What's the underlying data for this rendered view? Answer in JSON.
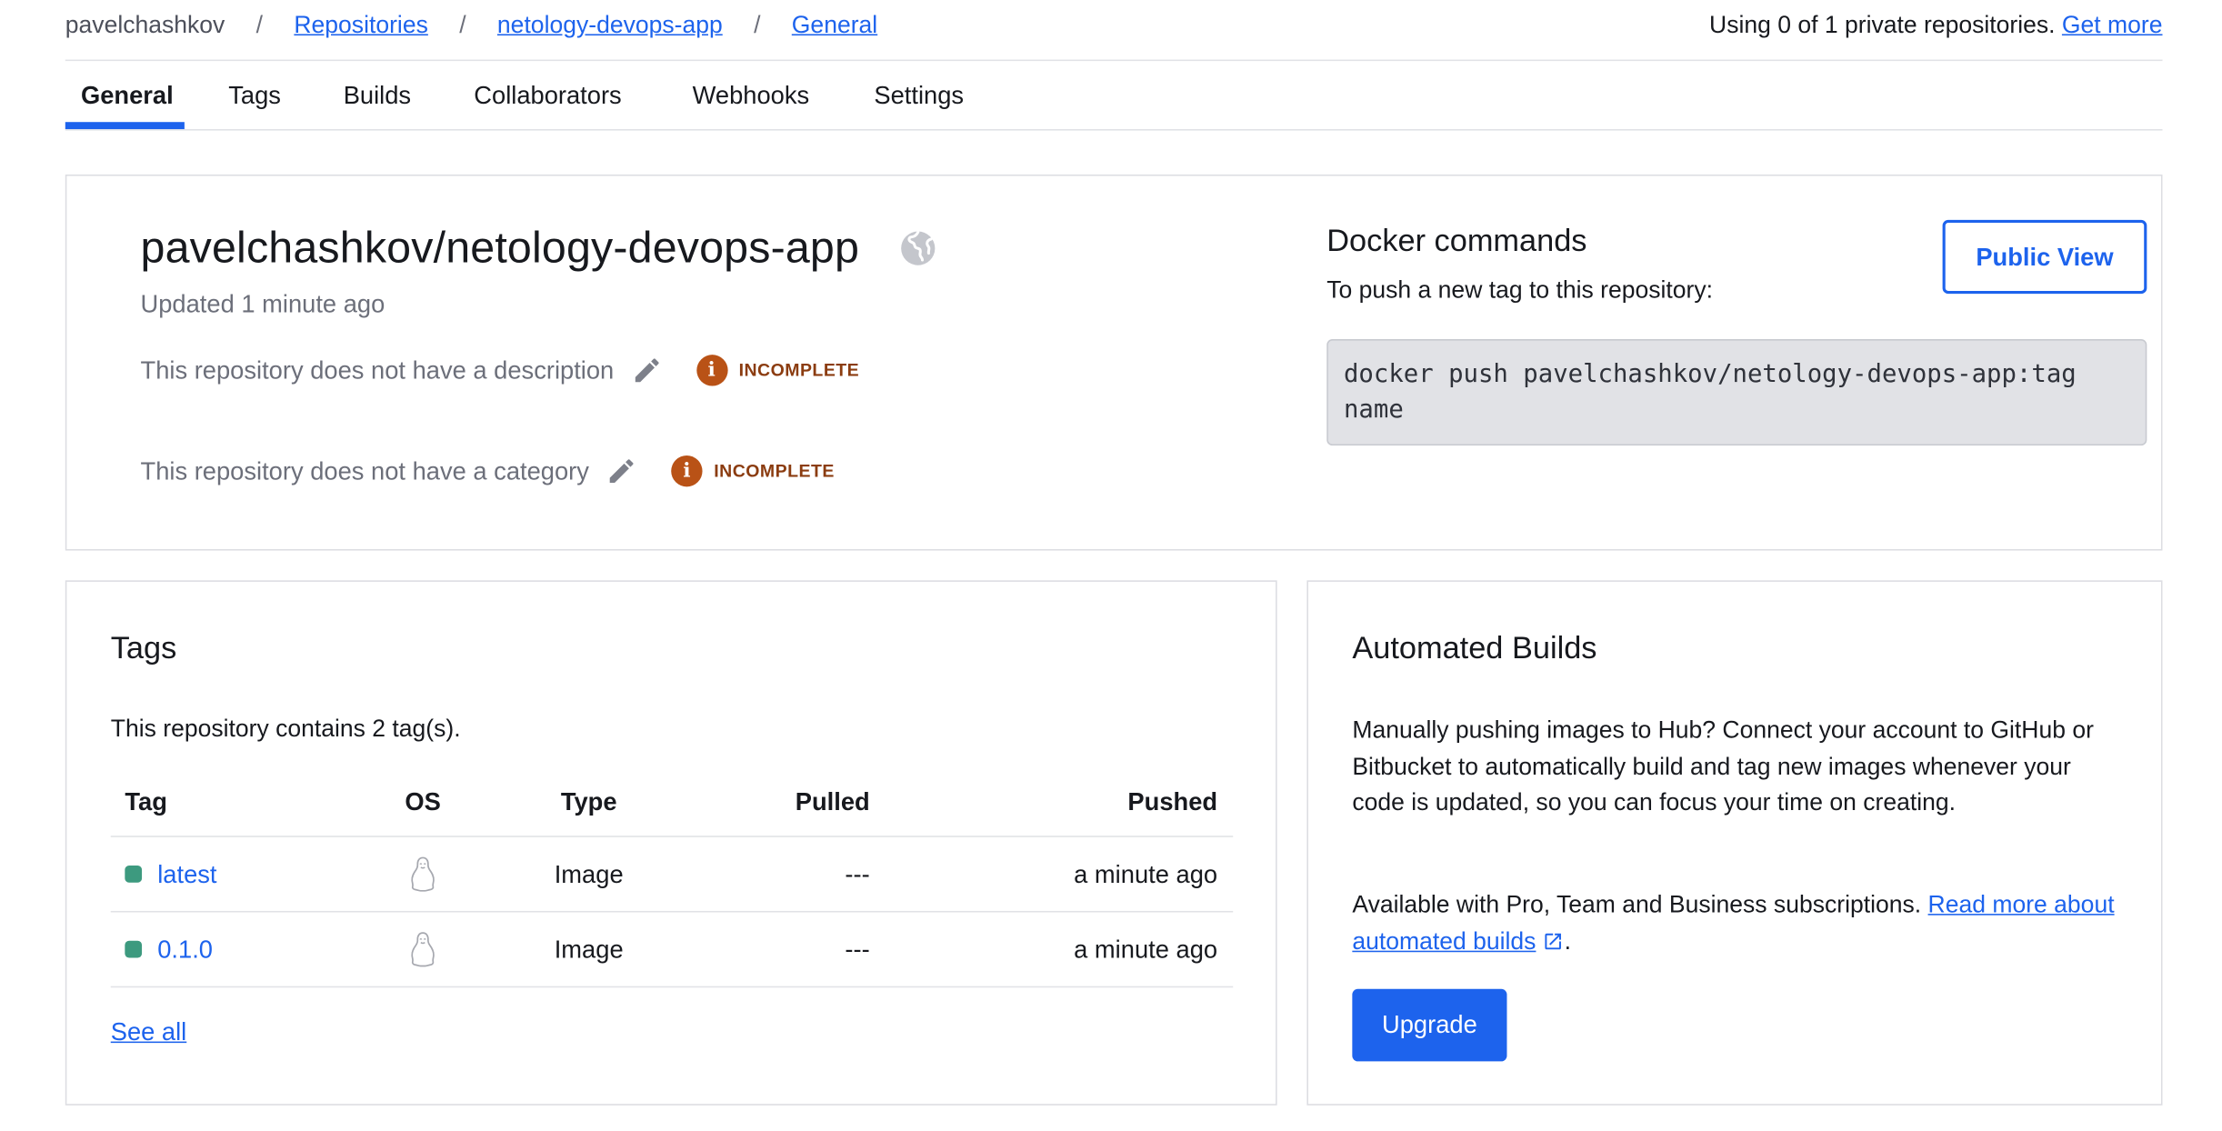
{
  "breadcrumb": {
    "owner": "pavelchashkov",
    "repositories": "Repositories",
    "repo": "netology-devops-app",
    "current": "General",
    "separator": "/"
  },
  "usage": {
    "text": "Using 0 of 1 private repositories.",
    "link": "Get more"
  },
  "tabs": [
    {
      "label": "General",
      "active": true
    },
    {
      "label": "Tags"
    },
    {
      "label": "Builds"
    },
    {
      "label": "Collaborators"
    },
    {
      "label": "Webhooks"
    },
    {
      "label": "Settings"
    }
  ],
  "repo": {
    "title": "pavelchashkov/netology-devops-app",
    "visibility_icon": "globe-icon",
    "updated": "Updated 1 minute ago",
    "description_text": "This repository does not have a description",
    "category_text": "This repository does not have a category",
    "badge": "INCOMPLETE"
  },
  "docker_commands": {
    "title": "Docker commands",
    "subtitle": "To push a new tag to this repository:",
    "command_line1": "docker push pavelchashkov/netology-devops-app:tag",
    "command_line2": "name",
    "public_view": "Public View"
  },
  "tags_card": {
    "title": "Tags",
    "count_text": "This repository contains 2 tag(s).",
    "columns": {
      "tag": "Tag",
      "os": "OS",
      "type": "Type",
      "pulled": "Pulled",
      "pushed": "Pushed"
    },
    "rows": [
      {
        "tag": "latest",
        "os_icon": "linux-icon",
        "type": "Image",
        "pulled": "---",
        "pushed": "a minute ago"
      },
      {
        "tag": "0.1.0",
        "os_icon": "linux-icon",
        "type": "Image",
        "pulled": "---",
        "pushed": "a minute ago"
      }
    ],
    "see_all": "See all"
  },
  "builds_card": {
    "title": "Automated Builds",
    "para1": "Manually pushing images to Hub? Connect your account to GitHub or Bitbucket to automatically build and tag new images whenever your code is updated, so you can focus your time on creating.",
    "para2_text": "Available with Pro, Team and Business subscriptions.",
    "para2_link": "Read more about automated builds",
    "para2_end": ".",
    "upgrade": "Upgrade"
  },
  "colors": {
    "accent": "#1d63ed",
    "incomplete": "#b95216",
    "tag_status": "#3d9a7f"
  }
}
